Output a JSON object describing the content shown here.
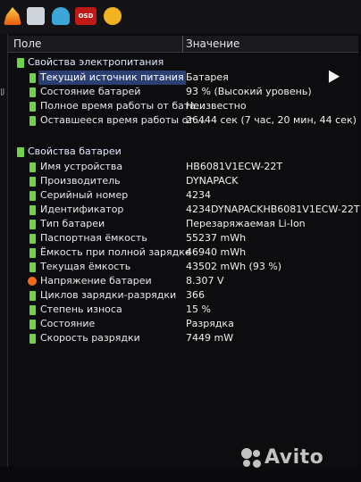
{
  "header": {
    "field": "Поле",
    "value": "Значение"
  },
  "power": {
    "title": "Свойства электропитания",
    "rows": [
      {
        "name": "Текущий источник питания",
        "value": "Батарея"
      },
      {
        "name": "Состояние батарей",
        "value": "93 % (Высокий уровень)"
      },
      {
        "name": "Полное время работы от бата...",
        "value": "Неизвестно"
      },
      {
        "name": "Оставшееся время работы от ...",
        "value": "26444 сек (7 час, 20 мин, 44 сек)"
      }
    ]
  },
  "battery": {
    "title": "Свойства батареи",
    "rows": [
      {
        "name": "Имя устройства",
        "value": "HB6081V1ECW-22T"
      },
      {
        "name": "Производитель",
        "value": "DYNAPACK"
      },
      {
        "name": "Серийный номер",
        "value": "4234"
      },
      {
        "name": "Идентификатор",
        "value": "4234DYNAPACKHB6081V1ECW-22T"
      },
      {
        "name": "Тип батареи",
        "value": "Перезаряжаемая Li-Ion"
      },
      {
        "name": "Паспортная ёмкость",
        "value": "55237 mWh"
      },
      {
        "name": "Ёмкость при полной зарядке",
        "value": "46940 mWh"
      },
      {
        "name": "Текущая ёмкость",
        "value": "43502 mWh  (93 %)"
      },
      {
        "name": "Напряжение батареи",
        "value": "8.307 V"
      },
      {
        "name": "Циклов зарядки-разрядки",
        "value": "366"
      },
      {
        "name": "Степень износа",
        "value": "15 %"
      },
      {
        "name": "Состояние",
        "value": "Разрядка"
      },
      {
        "name": "Скорость разрядки",
        "value": "7449 mW"
      }
    ]
  },
  "toolbar": {
    "osd_label": "OSD"
  },
  "watermark": "Avito",
  "colors": {
    "selection": "#2c3f73",
    "battery_icon": "#6fd24a",
    "voltage_icon": "#f26b1d"
  }
}
